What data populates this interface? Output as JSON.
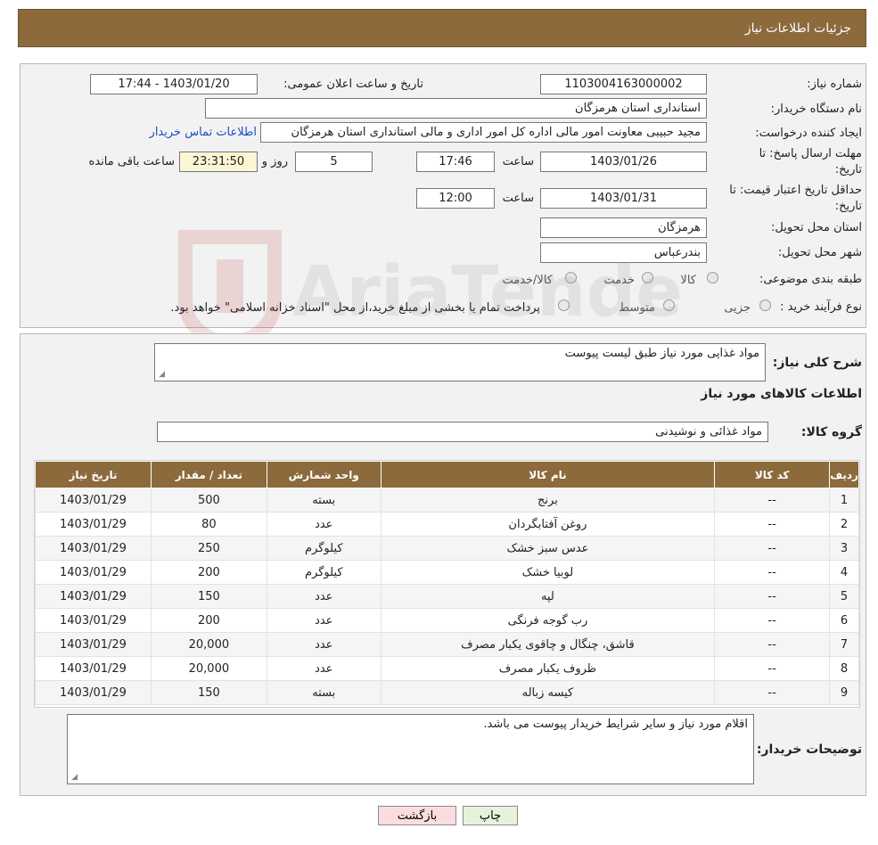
{
  "header": {
    "title": "جزئیات اطلاعات نیاز"
  },
  "fields": {
    "need_number_label": "شماره نیاز:",
    "need_number": "1103004163000002",
    "announce_label": "تاریخ و ساعت اعلان عمومی:",
    "announce_value": "1403/01/20 - 17:44",
    "buyer_label": "نام دستگاه خریدار:",
    "buyer_value": "استانداری استان هرمزگان",
    "creator_label": "ایجاد کننده درخواست:",
    "creator_value": "مجید حبیبی معاونت امور مالی اداره کل امور اداری و مالی استانداری استان هرمزگان",
    "contact_link": "اطلاعات تماس خریدار",
    "deadline_label_1": "مهلت ارسال پاسخ: تا",
    "deadline_label_2": "تاریخ:",
    "deadline_date": "1403/01/26",
    "time_label": "ساعت",
    "deadline_time": "17:46",
    "days_value": "5",
    "days_label": "روز و",
    "remaining_value": "23:31:50",
    "remaining_label": "ساعت باقی مانده",
    "validity_label_1": "حداقل تاریخ اعتبار قیمت: تا",
    "validity_label_2": "تاریخ:",
    "validity_date": "1403/01/31",
    "validity_time_label": "ساعت",
    "validity_time": "12:00",
    "province_label": "استان محل تحویل:",
    "province_value": "هرمزگان",
    "city_label": "شهر محل تحویل:",
    "city_value": "بندرعباس",
    "category_label": "طبقه بندی موضوعی:",
    "category_options": [
      "کالا",
      "خدمت",
      "کالا/خدمت"
    ],
    "process_label": "نوع فرآیند خرید :",
    "process_options": [
      "جزیی",
      "متوسط"
    ],
    "process_note": "پرداخت تمام یا بخشی از مبلغ خرید،از محل \"اسناد خزانه اسلامی\" خواهد بود."
  },
  "description": {
    "label": "شرح کلی نیاز:",
    "value": "مواد غذایی مورد نیاز طبق لیست پیوست"
  },
  "goods_section": {
    "title": "اطلاعات کالاهای مورد نیاز",
    "group_label": "گروه کالا:",
    "group_value": "مواد غذائی و نوشیدنی"
  },
  "table": {
    "headers": [
      "ردیف",
      "کد کالا",
      "نام کالا",
      "واحد شمارش",
      "تعداد / مقدار",
      "تاریخ نیاز"
    ],
    "rows": [
      [
        "1",
        "--",
        "برنج",
        "بسته",
        "500",
        "1403/01/29"
      ],
      [
        "2",
        "--",
        "روغن آفتابگردان",
        "عدد",
        "80",
        "1403/01/29"
      ],
      [
        "3",
        "--",
        "عدس سبز خشک",
        "کیلوگرم",
        "250",
        "1403/01/29"
      ],
      [
        "4",
        "--",
        "لوبیا خشک",
        "کیلوگرم",
        "200",
        "1403/01/29"
      ],
      [
        "5",
        "--",
        "لپه",
        "عدد",
        "150",
        "1403/01/29"
      ],
      [
        "6",
        "--",
        "رب گوجه فرنگی",
        "عدد",
        "200",
        "1403/01/29"
      ],
      [
        "7",
        "--",
        "قاشق، چنگال و چاقوی یکبار مصرف",
        "عدد",
        "20,000",
        "1403/01/29"
      ],
      [
        "8",
        "--",
        "ظروف یکبار مصرف",
        "عدد",
        "20,000",
        "1403/01/29"
      ],
      [
        "9",
        "--",
        "کیسه زباله",
        "بسته",
        "150",
        "1403/01/29"
      ]
    ]
  },
  "buyer_notes": {
    "label": "توضیحات خریدار:",
    "value": "اقلام مورد نیاز و سایر شرایط خریدار پیوست می باشد."
  },
  "buttons": {
    "print": "چاپ",
    "back": "بازگشت"
  },
  "watermark": {
    "text": "AriaTender.neT"
  },
  "colors": {
    "header": "#8c6a3c",
    "link": "#1d4bc7"
  }
}
